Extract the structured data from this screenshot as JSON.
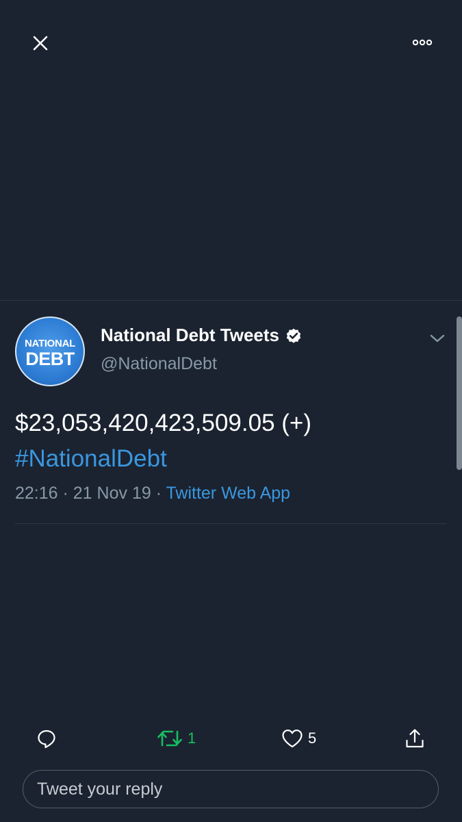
{
  "top_bar": {
    "close_icon": "close-icon",
    "more_icon": "more-options-icon"
  },
  "tweet": {
    "avatar": {
      "line1": "NATIONAL",
      "line2": "DEBT"
    },
    "display_name": "National Debt Tweets",
    "verified_icon": "verified-badge-icon",
    "handle": "@NationalDebt",
    "caret_icon": "chevron-down-icon",
    "text": "$23,053,420,423,509.05 (+)",
    "hashtag": "#NationalDebt",
    "time": "22:16",
    "separator1": " · ",
    "date": "21 Nov 19",
    "separator2": " · ",
    "source": "Twitter Web App"
  },
  "actions": {
    "reply": {
      "icon": "reply-icon",
      "count": ""
    },
    "retweet": {
      "icon": "retweet-icon",
      "count": "1",
      "color": "#17bf63"
    },
    "like": {
      "icon": "heart-icon",
      "count": "5"
    },
    "share": {
      "icon": "share-icon",
      "count": ""
    }
  },
  "reply_input": {
    "placeholder": "Tweet your reply"
  },
  "colors": {
    "background": "#1b2330",
    "link": "#3a97e0",
    "secondary_text": "#8899a6",
    "retweet_green": "#17bf63"
  }
}
